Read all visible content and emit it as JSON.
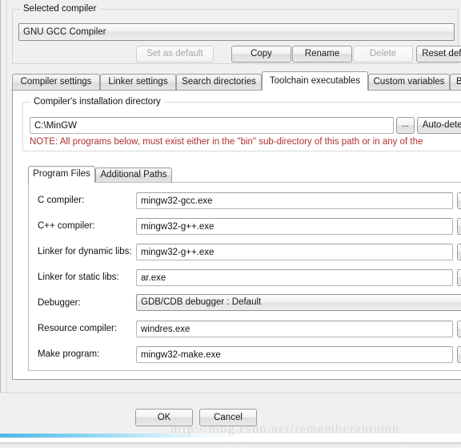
{
  "dialog": {
    "selected_compiler_group_title": "Selected compiler",
    "compiler_combo_value": "GNU GCC Compiler",
    "buttons": {
      "set_as_default": "Set as default",
      "copy": "Copy",
      "rename": "Rename",
      "delete": "Delete",
      "reset_defaults": "Reset defa"
    }
  },
  "main_tabs": [
    {
      "label": "Compiler settings",
      "selected": false
    },
    {
      "label": "Linker settings",
      "selected": false
    },
    {
      "label": "Search directories",
      "selected": false
    },
    {
      "label": "Toolchain executables",
      "selected": true
    },
    {
      "label": "Custom variables",
      "selected": false
    },
    {
      "label": "Bu",
      "selected": false
    }
  ],
  "install_dir": {
    "group_title": "Compiler's installation directory",
    "value": "C:\\MinGW",
    "placeholder": "",
    "browse_label": "...",
    "auto_detect_label": "Auto-detec",
    "note": "NOTE: All programs below, must exist either in the \"bin\" sub-directory of this path or in any of the",
    "note_color": "#b03030"
  },
  "inner_tabs": [
    {
      "label": "Program Files",
      "selected": true
    },
    {
      "label": "Additional Paths",
      "selected": false
    }
  ],
  "fields": [
    {
      "label": "C compiler:",
      "value": "mingw32-gcc.exe",
      "type": "text",
      "browse": "..."
    },
    {
      "label": "C++ compiler:",
      "value": "mingw32-g++.exe",
      "type": "text",
      "browse": "..."
    },
    {
      "label": "Linker for dynamic libs:",
      "value": "mingw32-g++.exe",
      "type": "text",
      "browse": "..."
    },
    {
      "label": "Linker for static libs:",
      "value": "ar.exe",
      "type": "text",
      "browse": "..."
    },
    {
      "label": "Debugger:",
      "value": "GDB/CDB debugger : Default",
      "type": "combo",
      "browse": ""
    },
    {
      "label": "Resource compiler:",
      "value": "windres.exe",
      "type": "text",
      "browse": "..."
    },
    {
      "label": "Make program:",
      "value": "mingw32-make.exe",
      "type": "text",
      "browse": "..."
    }
  ],
  "footer": {
    "ok": "OK",
    "cancel": "Cancel"
  },
  "watermark": {
    "text": "http://blog.csdn.net/rememberautumn"
  }
}
